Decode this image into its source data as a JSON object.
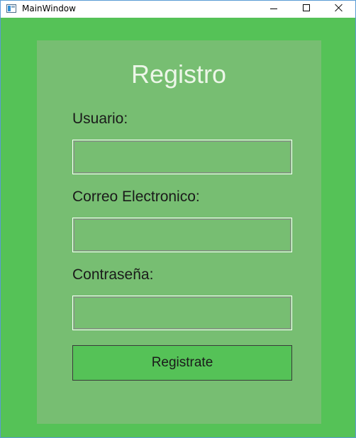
{
  "window": {
    "title": "MainWindow"
  },
  "titlebar_icons": {
    "app": "window-app-icon",
    "minimize": "minimize-icon",
    "maximize": "maximize-icon",
    "close": "close-icon"
  },
  "form": {
    "heading": "Registro",
    "fields": [
      {
        "label": "Usuario:",
        "value": ""
      },
      {
        "label": "Correo Electronico:",
        "value": ""
      },
      {
        "label": "Contraseña:",
        "value": ""
      }
    ],
    "submit_label": "Registrate"
  },
  "colors": {
    "window_background": "#55c257",
    "panel_background": "#77be72",
    "heading_text": "#ecf6e8",
    "button_background": "#55c257"
  }
}
